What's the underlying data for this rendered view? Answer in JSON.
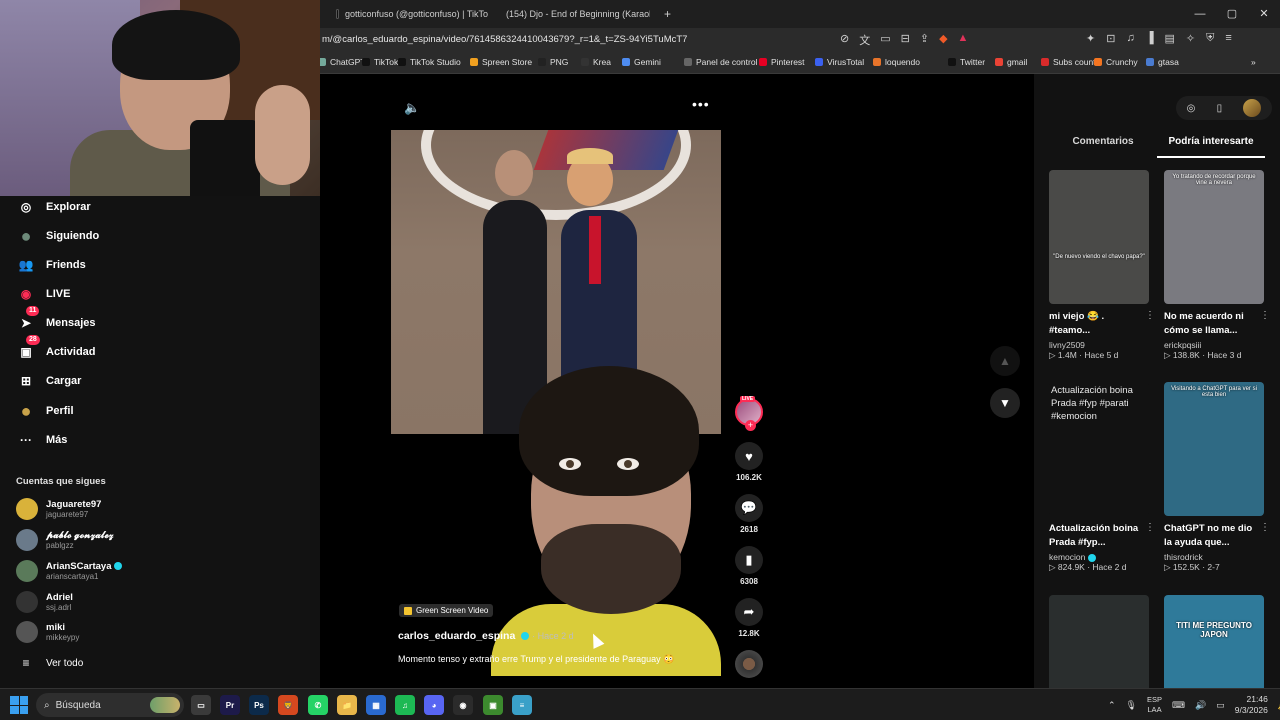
{
  "browser": {
    "tabs": [
      {
        "title": "gotticonfuso (@gotticonfuso) | TikTo",
        "color": "#111111"
      },
      {
        "title": "(154) Djo - End of Beginning (Karaok",
        "color": "#ff0000"
      }
    ],
    "new_tab_icon": "+",
    "window_controls": {
      "minimize": "—",
      "maximize": "▢",
      "close": "✕"
    },
    "url": "m/@carlos_eduardo_espina/video/7614586324410043679?_r=1&_t=ZS-94Yi5TuMcT7",
    "bookmarks": [
      {
        "label": "ChatGPT",
        "color": "#74aa9c"
      },
      {
        "label": "TikTok",
        "color": "#111111"
      },
      {
        "label": "TikTok Studio",
        "color": "#111111"
      },
      {
        "label": "Spreen Store",
        "color": "#f0a020"
      },
      {
        "label": "PNG",
        "color": "#222222"
      },
      {
        "label": "Krea",
        "color": "#333333"
      },
      {
        "label": "Gemini",
        "color": "#4e8cf0"
      },
      {
        "label": "Panel de control",
        "color": "#666666"
      },
      {
        "label": "Pinterest",
        "color": "#e60023"
      },
      {
        "label": "VirusTotal",
        "color": "#3b61f0"
      },
      {
        "label": "loquendo",
        "color": "#e8742a"
      },
      {
        "label": "Twitter",
        "color": "#111111"
      },
      {
        "label": "gmail",
        "color": "#ea4335"
      },
      {
        "label": "Subs count",
        "color": "#d92b2b"
      },
      {
        "label": "Crunchy",
        "color": "#f47521"
      },
      {
        "label": "gtasa",
        "color": "#4a7bd0"
      }
    ],
    "bookmarks_overflow": "»"
  },
  "sidebar": {
    "items": [
      {
        "label": "Explorar",
        "icon": "compass-icon",
        "glyph": "◎"
      },
      {
        "label": "Siguiendo",
        "icon": "following-avatar-icon",
        "glyph": "●"
      },
      {
        "label": "Friends",
        "icon": "friends-icon",
        "glyph": "👥"
      },
      {
        "label": "LIVE",
        "icon": "live-icon",
        "glyph": "◉"
      },
      {
        "label": "Mensajes",
        "icon": "messages-icon",
        "glyph": "➤",
        "badge": "11"
      },
      {
        "label": "Actividad",
        "icon": "activity-icon",
        "glyph": "▣",
        "badge": "28"
      },
      {
        "label": "Cargar",
        "icon": "upload-icon",
        "glyph": "⊞"
      },
      {
        "label": "Perfil",
        "icon": "profile-avatar-icon",
        "glyph": "●"
      },
      {
        "label": "Más",
        "icon": "more-icon",
        "glyph": "···"
      }
    ],
    "following_title": "Cuentas que sigues",
    "accounts": [
      {
        "name": "Jaguarete97",
        "handle": "jaguarete97",
        "color": "#d9b23a",
        "verified": false
      },
      {
        "name": "𝓹𝓪𝓫𝓵𝓸 𝓰𝓸𝓷𝔃𝓪𝓵𝓮𝔃",
        "handle": "pablgzz",
        "color": "#6a7a8a",
        "verified": false
      },
      {
        "name": "ArianSCartaya",
        "handle": "arianscartaya1",
        "color": "#5a7a5a",
        "verified": true
      },
      {
        "name": "Adriel",
        "handle": "ssj.adrl",
        "color": "#333333",
        "verified": false
      },
      {
        "name": "miki",
        "handle": "mikkeypy",
        "color": "#555555",
        "verified": false
      }
    ],
    "see_all": "Ver todo"
  },
  "video": {
    "tag": "Green Screen Video",
    "author": "carlos_eduardo_espina",
    "age": "· Hace 2 d",
    "caption": "Momento tenso y extraño erre Trump y el presidente de Paraguay 😳",
    "progress": 0.93,
    "actions": {
      "likes": "106.2K",
      "comments": "2618",
      "saves": "6308",
      "shares": "12.8K",
      "live_label": "LIVE"
    }
  },
  "right_panel": {
    "tabs": [
      "Comentarios",
      "Podría interesarte"
    ],
    "active_tab": 1,
    "cards": [
      {
        "title": "mi viejo 😂 . #teamo...",
        "author": "livny2509",
        "views": "1.4M",
        "age": "Hace 5 d",
        "overlay": "\"De nuevo viendo el chavo papa?\"",
        "bg": "#4a4a48",
        "broken": false,
        "verified": false
      },
      {
        "title": "No me acuerdo ni cómo se llama...",
        "author": "erickpqsiii",
        "views": "138.8K",
        "age": "Hace 3 d",
        "overlay": "Yo tratando de recordar porque vine a nevera",
        "bg": "#7a7a80",
        "broken": false,
        "verified": false
      },
      {
        "title": "Actualización boina Prada #fyp...",
        "author": "kemocion",
        "views": "824.9K",
        "age": "Hace 2 d",
        "overlay": "Actualización boina Prada #fyp #parati #kemocion",
        "bg": "#121212",
        "broken": true,
        "verified": true
      },
      {
        "title": "ChatGPT no me dio la ayuda que...",
        "author": "thisrodrick",
        "views": "152.5K",
        "age": "2-7",
        "overlay": "Visitando a ChatGPT para ver si esta bien",
        "bg": "#2f6a84",
        "broken": false,
        "verified": false
      },
      {
        "title": "",
        "author": "",
        "views": "",
        "age": "",
        "overlay": "",
        "bg": "#2a2e2e",
        "broken": false,
        "verified": false
      },
      {
        "title": "",
        "author": "",
        "views": "",
        "age": "",
        "overlay": "TITI ME PREGUNTO JAPON",
        "bg": "#2f7a9a",
        "broken": false,
        "verified": false
      }
    ]
  },
  "taskbar": {
    "search_placeholder": "Búsqueda",
    "lang_line1": "ESP",
    "lang_line2": "LAA",
    "time": "21:46",
    "date": "9/3/2026",
    "apps": [
      {
        "name": "task-view",
        "label": "▭",
        "color": "#3a3a3a"
      },
      {
        "name": "premiere-pro",
        "label": "Pr",
        "color": "#1d1a4a"
      },
      {
        "name": "photoshop",
        "label": "Ps",
        "color": "#0c2a4a"
      },
      {
        "name": "brave",
        "label": "🦁",
        "color": "#d5481f"
      },
      {
        "name": "whatsapp",
        "label": "✆",
        "color": "#25d366"
      },
      {
        "name": "file-explorer",
        "label": "📁",
        "color": "#e8b64a"
      },
      {
        "name": "store",
        "label": "▦",
        "color": "#2a6ad0"
      },
      {
        "name": "spotify",
        "label": "♫",
        "color": "#1db954"
      },
      {
        "name": "discord",
        "label": "◕",
        "color": "#5865f2"
      },
      {
        "name": "obs",
        "label": "◉",
        "color": "#2b2b2b"
      },
      {
        "name": "minecraft",
        "label": "▣",
        "color": "#3c8a2e"
      },
      {
        "name": "notepad",
        "label": "≡",
        "color": "#3aa0c8"
      }
    ]
  }
}
